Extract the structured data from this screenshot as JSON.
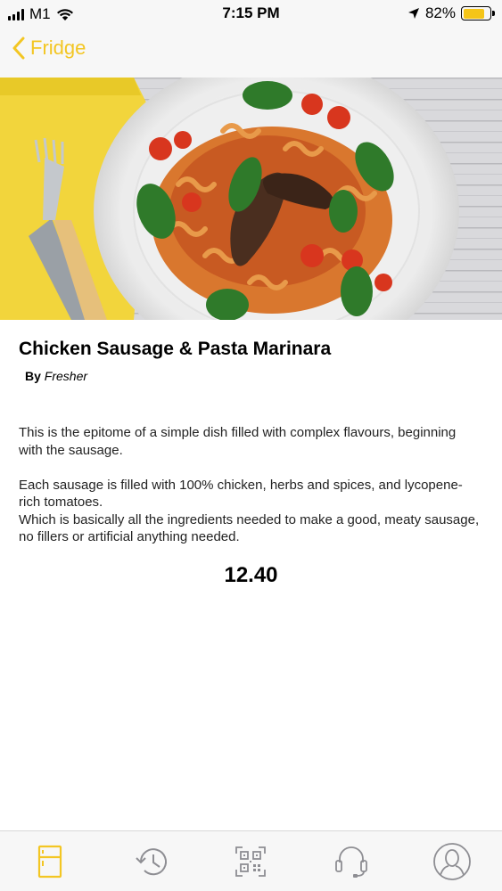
{
  "status_bar": {
    "carrier": "M1",
    "time": "7:15 PM",
    "battery_percent": "82%",
    "battery_level": 0.82,
    "battery_color": "#f5c518"
  },
  "nav": {
    "back_label": "Fridge",
    "accent_color": "#f3c623"
  },
  "hero": {
    "image_icon": "pasta-dish-photo"
  },
  "product": {
    "title": "Chicken Sausage & Pasta Marinara",
    "by_label": "By",
    "author": "Fresher",
    "description": "This is the epitome of a simple dish filled with complex flavours, beginning with the sausage.\n\nEach sausage is filled with 100% chicken, herbs and spices, and lycopene-rich tomatoes.\nWhich is basically all the ingredients needed to make a good, meaty sausage, no fillers or artificial anything needed.",
    "price": "12.40"
  },
  "tab_bar": {
    "tabs": [
      {
        "icon": "fridge-icon",
        "active": true
      },
      {
        "icon": "history-icon",
        "active": false
      },
      {
        "icon": "qr-code-icon",
        "active": false
      },
      {
        "icon": "headset-icon",
        "active": false
      },
      {
        "icon": "profile-icon",
        "active": false
      }
    ],
    "active_color": "#f3c623",
    "inactive_color": "#8e8e93"
  }
}
